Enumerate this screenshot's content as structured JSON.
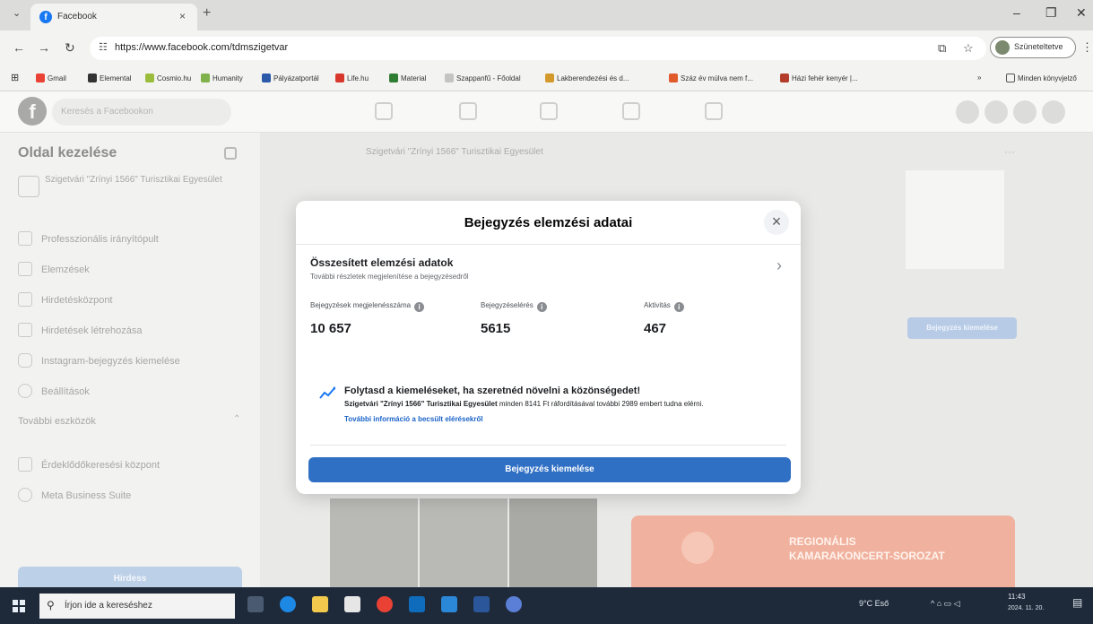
{
  "browser": {
    "tab_title": "Facebook",
    "tab_close": "×",
    "new_tab": "+",
    "url": "https://www.facebook.com/tdmszigetvar",
    "profile_label": "Szüneteltetve",
    "bookmarks": [
      "Gmail",
      "Elemental",
      "Cosmio.hu",
      "Humanity",
      "Pályázatportál",
      "Life.hu",
      "Material",
      "Szappanfű - Főoldal",
      "Lakberendezési és d...",
      "Száz év múlva nem f...",
      "Házi fehér kenyér |..."
    ],
    "bookmarks_more": "»",
    "all_bookmarks": "Minden könyvjelző"
  },
  "facebook": {
    "logo": "f",
    "search_placeholder": "Keresés a Facebookon"
  },
  "sidebar": {
    "title": "Oldal kezelése",
    "page_name": "Szigetvári \"Zrínyi 1566\" Turisztikai Egyesület",
    "items": [
      "Professzionális irányítópult",
      "Elemzések",
      "Hirdetésközpont",
      "Hirdetések létrehozása",
      "Instagram-bejegyzés kiemelése",
      "Beállítások"
    ],
    "section_more": "További eszközök",
    "more_items": [
      "Érdeklődőkeresési központ",
      "Meta Business Suite"
    ],
    "promote_button": "Hirdess"
  },
  "background": {
    "post_author": "Szigetvári \"Zrínyi 1566\" Turisztikai Egyesület",
    "boost_button": "Bejegyzés kiemelése",
    "banner_line1": "REGIONÁLIS",
    "banner_line2": "KAMARAKONCERT-SOROZAT"
  },
  "modal": {
    "title": "Bejegyzés elemzési adatai",
    "close": "×",
    "section_title": "Összesített elemzési adatok",
    "section_subtitle": "További részletek megjelenítése a bejegyzésedről",
    "metrics": [
      {
        "label": "Bejegyzések megjelenésszáma",
        "value": "10 657"
      },
      {
        "label": "Bejegyzéselérés",
        "value": "5615"
      },
      {
        "label": "Aktivitás",
        "value": "467"
      }
    ],
    "tip_title": "Folytasd a kiemeléseket, ha szeretnéd növelni a közönségedet!",
    "tip_page": "Szigetvári \"Zrínyi 1566\" Turisztikai Egyesület",
    "tip_rest": "minden 8141 Ft ráfordításával további 2989 embert tudna elérni.",
    "tip_link": "További információ a becsült elérésekről",
    "boost_button": "Bejegyzés kiemelése"
  },
  "taskbar": {
    "search_placeholder": "Írjon ide a kereséshez",
    "weather": "9°C Eső",
    "time": "11:43",
    "date": "2024. 11. 20."
  },
  "colors": {
    "facebook_blue": "#1877f2",
    "boost_button": "#2f6fc4",
    "link": "#1b63c8",
    "taskbar": "#1e2a3a"
  }
}
